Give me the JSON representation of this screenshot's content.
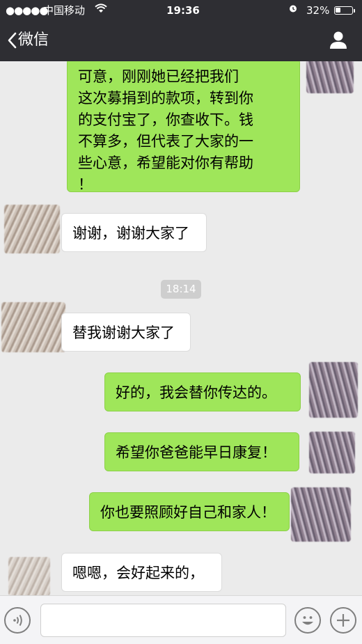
{
  "status_bar": {
    "signal_dots": "●●●●●",
    "carrier": "中国移动",
    "time": "19:36",
    "battery_percent": "32%",
    "battery_level": 0.32
  },
  "nav": {
    "back_label": "微信"
  },
  "chat": {
    "messages": [
      {
        "from": "me",
        "lines": [
          "可意，刚刚她已经把我们",
          "这次募捐到的款项，转到你",
          "的支付宝了，你查收下。钱",
          "不算多，但代表了大家的一",
          "些心意，希望能对你有帮助",
          "！"
        ]
      },
      {
        "from": "other",
        "text": "谢谢，谢谢大家了"
      },
      {
        "from": "other",
        "text": "替我谢谢大家了"
      },
      {
        "from": "me",
        "text": "好的，我会替你传达的。"
      },
      {
        "from": "me",
        "text": "希望你爸爸能早日康复！"
      },
      {
        "from": "me",
        "text": "你也要照顾好自己和家人！"
      },
      {
        "from": "other",
        "text": "嗯嗯，会好起来的，"
      }
    ],
    "timestamp": "18:14"
  },
  "input_bar": {
    "message_value": ""
  }
}
